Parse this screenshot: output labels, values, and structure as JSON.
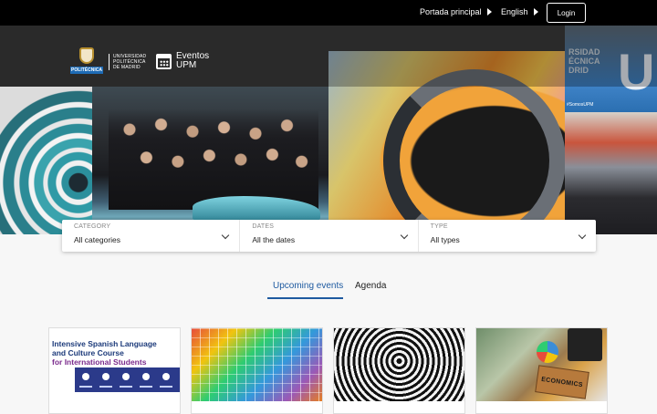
{
  "topbar": {
    "home_label": "Portada principal",
    "language_label": "English",
    "login_label": "Login"
  },
  "branding": {
    "university_line1": "UNIVERSIDAD",
    "university_line2": "POLITÉCNICA",
    "university_line3": "DE MADRID",
    "crest_band": "POLITÉCNICA",
    "events_line1": "Eventos",
    "events_line2": "UPM"
  },
  "hero": {
    "posters_text_line1": "RSIDAD",
    "posters_text_line2": "ÉCNICA",
    "posters_text_line3": "DRID",
    "posters_big_letter": "U",
    "posters_hashtag": "#SomosUPM"
  },
  "filters": [
    {
      "label": "CATEGORY",
      "value": "All categories"
    },
    {
      "label": "DATES",
      "value": "All the dates"
    },
    {
      "label": "TYPE",
      "value": "All types"
    }
  ],
  "tabs": [
    {
      "label": "Upcoming events",
      "active": true
    },
    {
      "label": "Agenda",
      "active": false
    }
  ],
  "cards": [
    {
      "title_line1": "Intensive Spanish Language",
      "title_line2": "and Culture Course",
      "title_line3": "for International Students"
    },
    {},
    {},
    {
      "book_label": "ECONOMICS"
    }
  ],
  "colors": {
    "accent": "#1e5aa0",
    "topbar": "#000000"
  }
}
